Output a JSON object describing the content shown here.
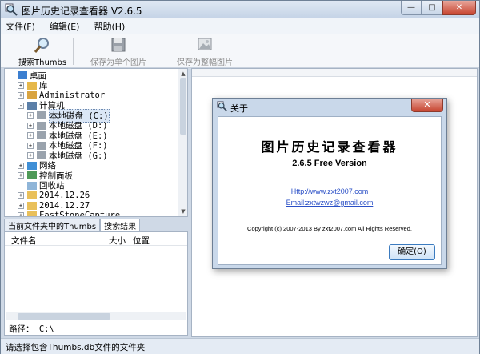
{
  "window": {
    "title": "图片历史记录查看器 V2.6.5",
    "buttons": {
      "minimize": "—",
      "maximize": "□",
      "close": "✕"
    }
  },
  "menu": [
    "文件(F)",
    "编辑(E)",
    "帮助(H)"
  ],
  "toolbar": {
    "search": "搜索Thumbs",
    "save_single": "保存为单个图片",
    "save_whole": "保存为整幅图片"
  },
  "tree": {
    "items": [
      {
        "label": "桌面",
        "level": 0,
        "expander": "",
        "icon": "desktop-icon"
      },
      {
        "label": "库",
        "level": 1,
        "expander": "+",
        "icon": "library-icon"
      },
      {
        "label": "Administrator",
        "level": 1,
        "expander": "+",
        "icon": "user-icon"
      },
      {
        "label": "计算机",
        "level": 1,
        "expander": "-",
        "icon": "computer-icon"
      },
      {
        "label": "本地磁盘 (C:)",
        "level": 2,
        "expander": "+",
        "icon": "drive-icon",
        "selected": true
      },
      {
        "label": "本地磁盘 (D:)",
        "level": 2,
        "expander": "+",
        "icon": "drive-icon"
      },
      {
        "label": "本地磁盘 (E:)",
        "level": 2,
        "expander": "+",
        "icon": "drive-icon"
      },
      {
        "label": "本地磁盘 (F:)",
        "level": 2,
        "expander": "+",
        "icon": "drive-icon"
      },
      {
        "label": "本地磁盘 (G:)",
        "level": 2,
        "expander": "+",
        "icon": "drive-icon"
      },
      {
        "label": "网络",
        "level": 1,
        "expander": "+",
        "icon": "network-icon"
      },
      {
        "label": "控制面板",
        "level": 1,
        "expander": "+",
        "icon": "control-panel-icon"
      },
      {
        "label": "回收站",
        "level": 1,
        "expander": "",
        "icon": "recycle-bin-icon"
      },
      {
        "label": "2014.12.26",
        "level": 1,
        "expander": "+",
        "icon": "folder-icon"
      },
      {
        "label": "2014.12.27",
        "level": 1,
        "expander": "+",
        "icon": "folder-icon"
      },
      {
        "label": "FastStoneCapture..",
        "level": 1,
        "expander": "+",
        "icon": "folder-icon"
      }
    ]
  },
  "tabs": [
    "当前文件夹中的Thumbs",
    "搜索结果"
  ],
  "results": {
    "col_name": "文件名",
    "col_size": "大小",
    "col_pos": "位置"
  },
  "path": {
    "label": "路径：",
    "value": "C:\\"
  },
  "status": "请选择包含Thumbs.db文件的文件夹",
  "about": {
    "title": "关于",
    "close": "✕",
    "app_name": "图片历史记录查看器",
    "version": "2.6.5 Free Version",
    "url": "Http://www.zxt2007.com",
    "email": "Email:zxtwzwz@gmail.com",
    "copyright": "Copyright (c) 2007-2013 By zxt2007.com All Rights Reserved.",
    "ok": "确定(O)"
  }
}
